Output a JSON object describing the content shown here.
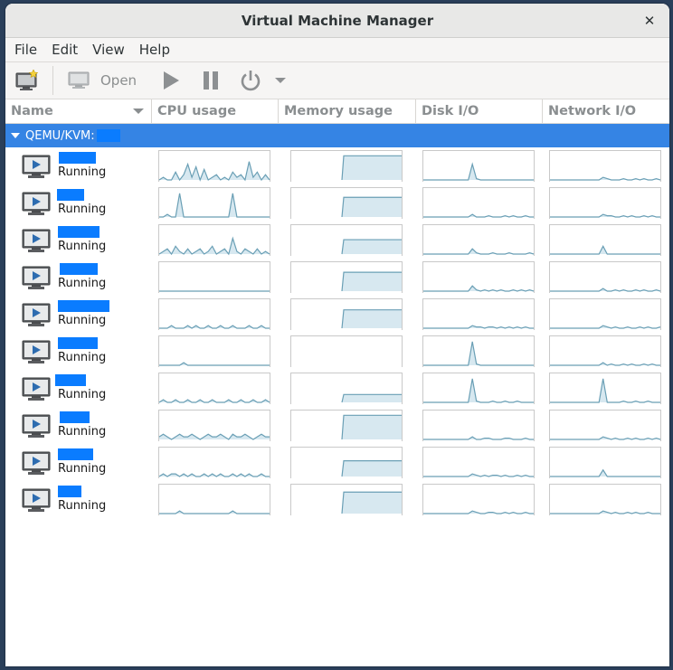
{
  "window": {
    "title": "Virtual Machine Manager",
    "close_glyph": "✕"
  },
  "menu": [
    "File",
    "Edit",
    "View",
    "Help"
  ],
  "toolbar": {
    "new_vm_icon": "new-vm-icon",
    "open_label": "Open",
    "run_icon": "play-icon",
    "pause_icon": "pause-icon",
    "shutdown_icon": "power-icon",
    "shutdown_menu_icon": "chevron-down-icon"
  },
  "columns": [
    "Name",
    "CPU usage",
    "Memory usage",
    "Disk I/O",
    "Network I/O"
  ],
  "group": {
    "label": "QEMU/KVM:"
  },
  "vms": [
    {
      "status": "Running"
    },
    {
      "status": "Running"
    },
    {
      "status": "Running"
    },
    {
      "status": "Running"
    },
    {
      "status": "Running"
    },
    {
      "status": "Running"
    },
    {
      "status": "Running"
    },
    {
      "status": "Running"
    },
    {
      "status": "Running"
    },
    {
      "status": "Running"
    }
  ],
  "colors": {
    "selection": "#3584e4",
    "redaction": "#0a7cff",
    "graph_line": "#6a9fb5",
    "graph_fill": "#d7e8f0"
  }
}
